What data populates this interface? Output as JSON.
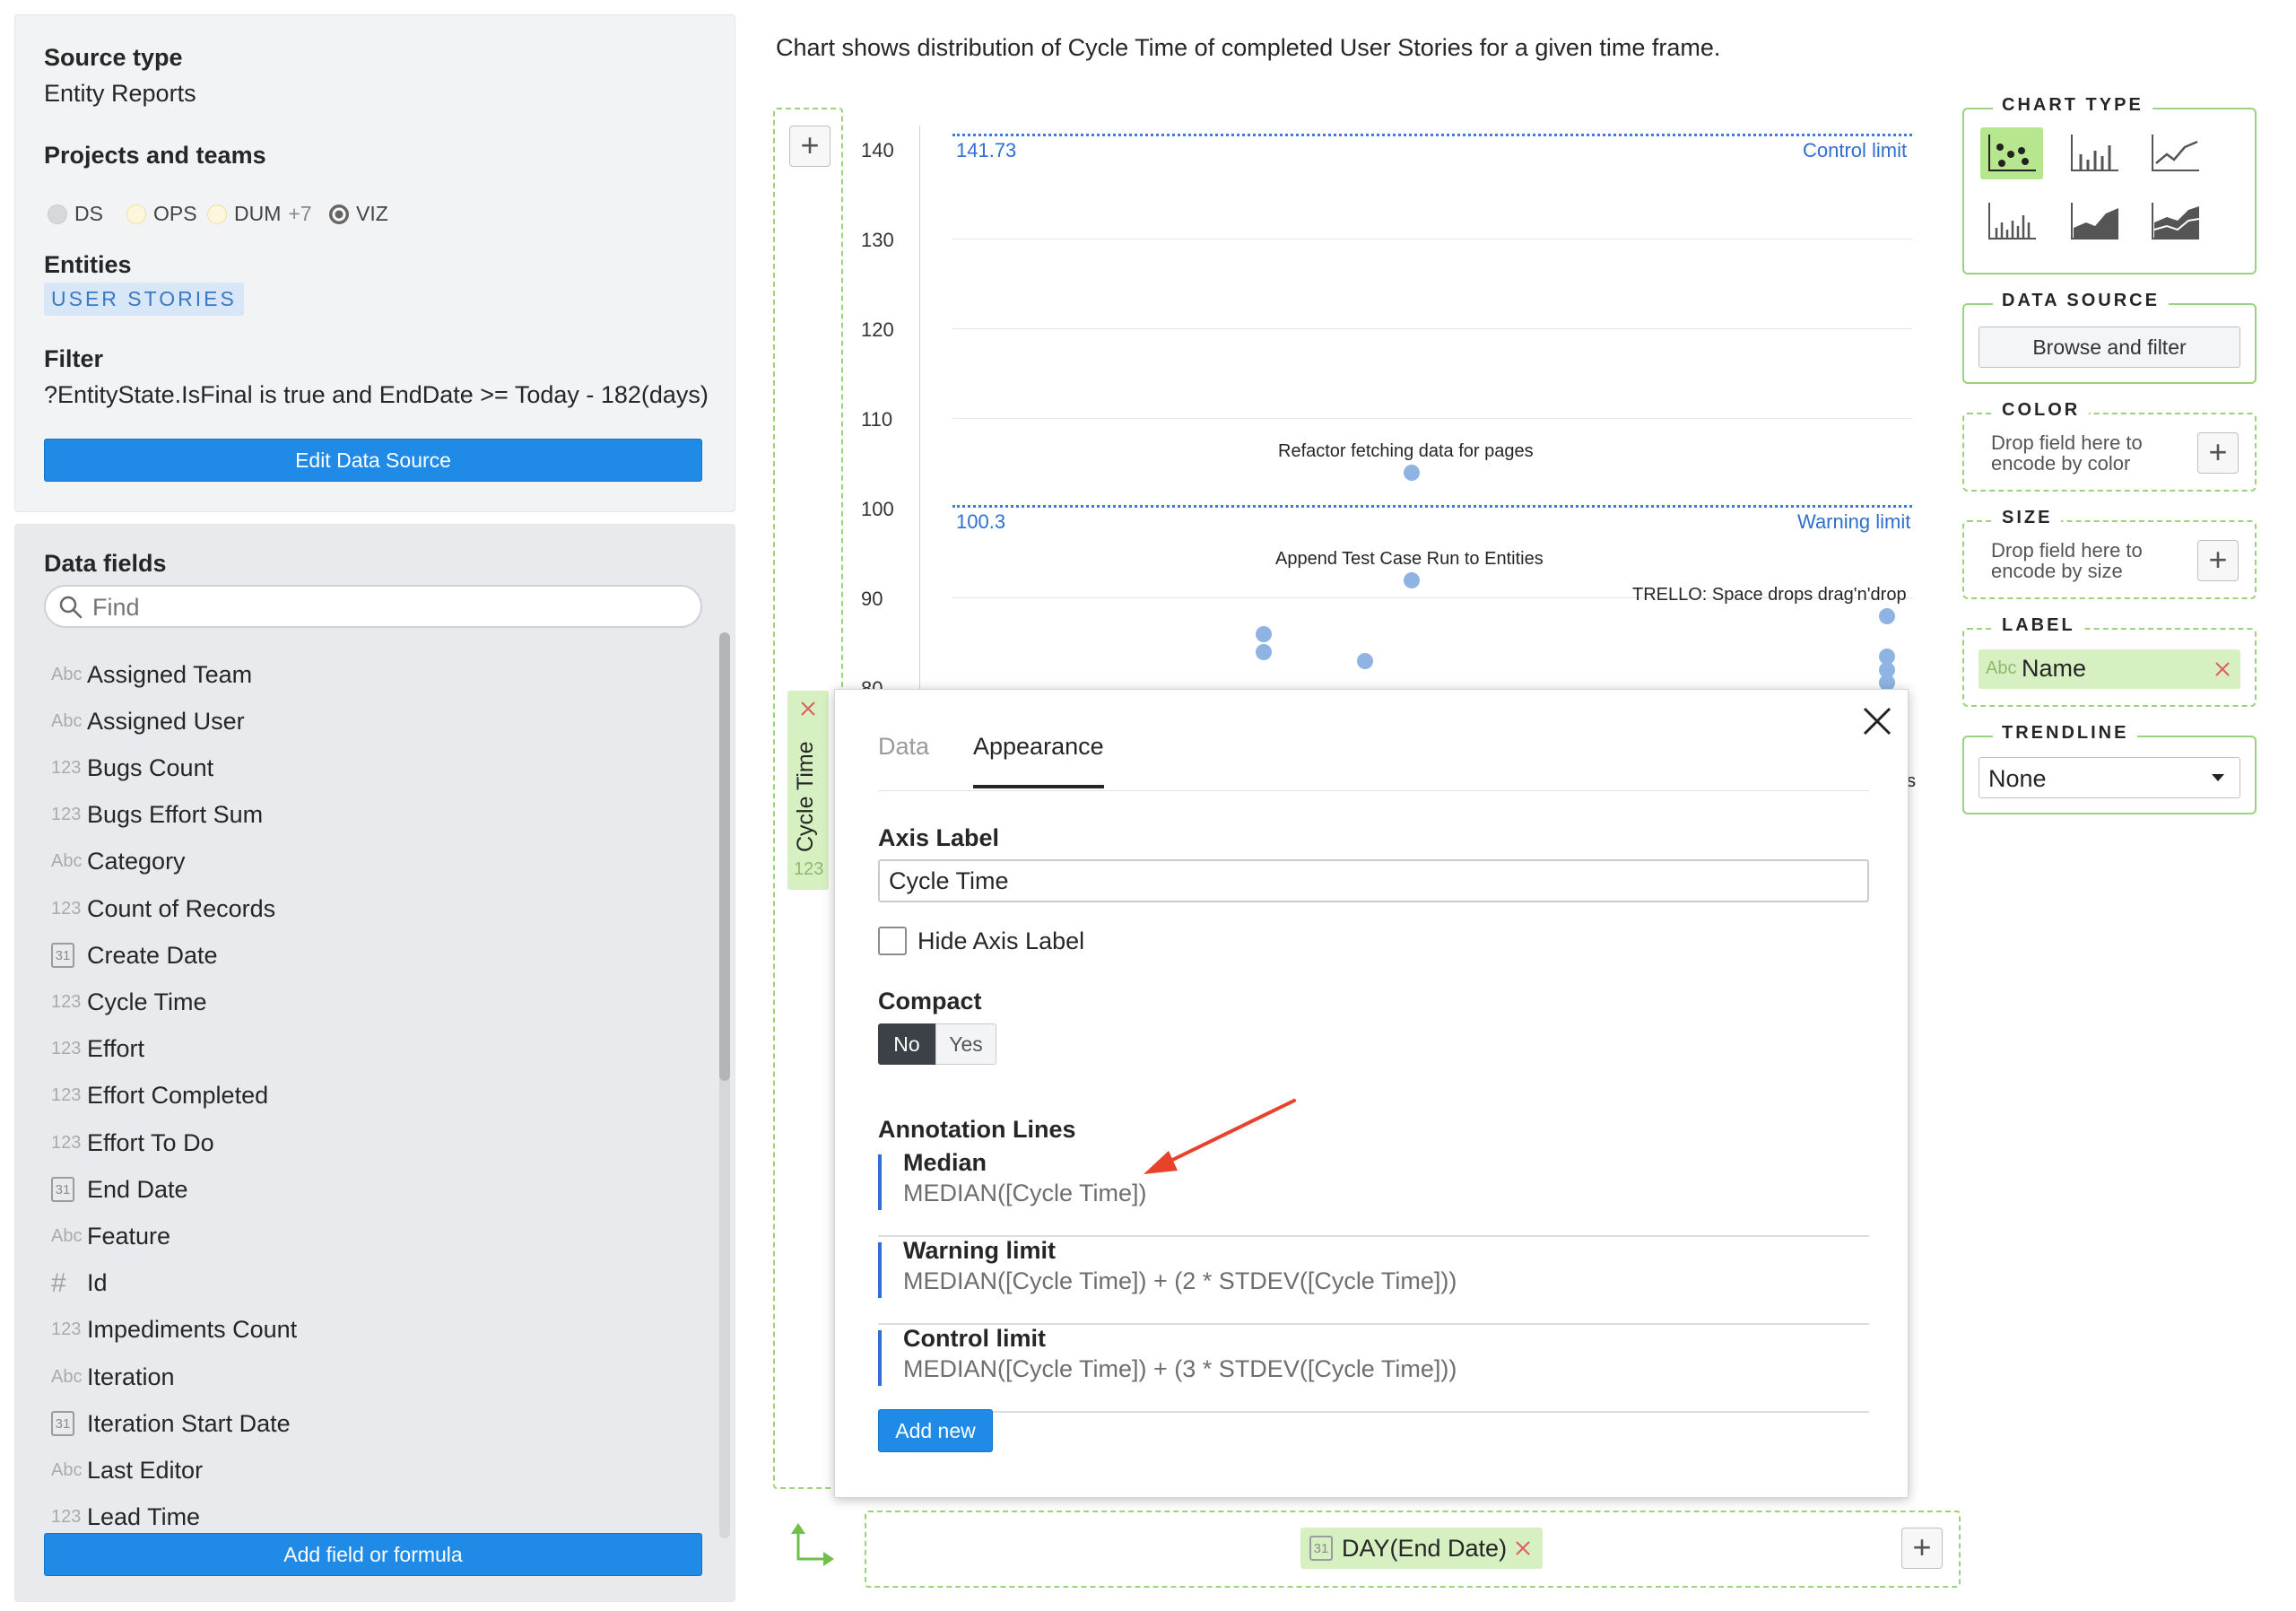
{
  "source": {
    "source_type_label": "Source type",
    "source_type_value": "Entity Reports",
    "projects_label": "Projects and teams",
    "projects": [
      {
        "name": "DS"
      },
      {
        "name": "OPS"
      },
      {
        "name": "DUM"
      },
      {
        "more": "+7"
      },
      {
        "name": "VIZ"
      }
    ],
    "entities_label": "Entities",
    "entity": "USER STORIES",
    "filter_label": "Filter",
    "filter_value": "?EntityState.IsFinal is true and EndDate >= Today - 182(days)",
    "edit_button": "Edit Data Source"
  },
  "fields": {
    "title": "Data fields",
    "search_placeholder": "Find",
    "items": [
      {
        "type": "Abc",
        "name": "Assigned Team"
      },
      {
        "type": "Abc",
        "name": "Assigned User"
      },
      {
        "type": "123",
        "name": "Bugs Count"
      },
      {
        "type": "123",
        "name": "Bugs Effort Sum"
      },
      {
        "type": "Abc",
        "name": "Category"
      },
      {
        "type": "123",
        "name": "Count of Records"
      },
      {
        "type": "31",
        "name": "Create Date"
      },
      {
        "type": "123",
        "name": "Cycle Time"
      },
      {
        "type": "123",
        "name": "Effort"
      },
      {
        "type": "123",
        "name": "Effort Completed"
      },
      {
        "type": "123",
        "name": "Effort To Do"
      },
      {
        "type": "31",
        "name": "End Date"
      },
      {
        "type": "Abc",
        "name": "Feature"
      },
      {
        "type": "#",
        "name": "Id"
      },
      {
        "type": "123",
        "name": "Impediments Count"
      },
      {
        "type": "Abc",
        "name": "Iteration"
      },
      {
        "type": "31",
        "name": "Iteration Start Date"
      },
      {
        "type": "Abc",
        "name": "Last Editor"
      },
      {
        "type": "123",
        "name": "Lead Time"
      }
    ],
    "add_button": "Add field or formula"
  },
  "chart": {
    "description": "Chart shows distribution of Cycle Time of completed User Stories for a given time frame.",
    "yaxis_field": "Cycle Time",
    "yaxis_type": "123",
    "xaxis_field": "DAY(End Date)",
    "xaxis_type": "31",
    "yticks": [
      "140",
      "130",
      "120",
      "110",
      "100",
      "90",
      "80"
    ],
    "control_value": "141.73",
    "control_label": "Control limit",
    "warning_value": "100.3",
    "warning_label": "Warning limit",
    "point_labels": {
      "p1": "Refactor fetching data for pages",
      "p2": "Append Test Case Run to Entities",
      "p3": "TRELLO: Space drops drag'n'drop"
    }
  },
  "modal": {
    "tab_data": "Data",
    "tab_appearance": "Appearance",
    "axis_label_title": "Axis Label",
    "axis_label_value": "Cycle Time",
    "hide_axis_label": "Hide Axis Label",
    "compact_title": "Compact",
    "compact_no": "No",
    "compact_yes": "Yes",
    "annotation_title": "Annotation Lines",
    "annotations": [
      {
        "name": "Median",
        "formula": "MEDIAN([Cycle Time])"
      },
      {
        "name": "Warning limit",
        "formula": "MEDIAN([Cycle Time]) + (2 * STDEV([Cycle Time]))"
      },
      {
        "name": "Control limit",
        "formula": "MEDIAN([Cycle Time]) + (3 * STDEV([Cycle Time]))"
      }
    ],
    "add_new": "Add new",
    "partial_char": "s"
  },
  "sidebar": {
    "chart_type_title": "CHART TYPE",
    "data_source_title": "DATA SOURCE",
    "browse_button": "Browse and filter",
    "color_title": "COLOR",
    "color_drop": "Drop field here to encode by color",
    "size_title": "SIZE",
    "size_drop": "Drop field here to encode by size",
    "label_title": "LABEL",
    "label_type": "Abc",
    "label_field": "Name",
    "trendline_title": "TRENDLINE",
    "trendline_value": "None"
  },
  "colors": {
    "primary_blue": "#1f8be6",
    "annotation_blue": "#2f6fd0",
    "green_accent": "#9cd27e",
    "point_blue": "#8fb4e4",
    "arrow_red": "#e8412c"
  }
}
